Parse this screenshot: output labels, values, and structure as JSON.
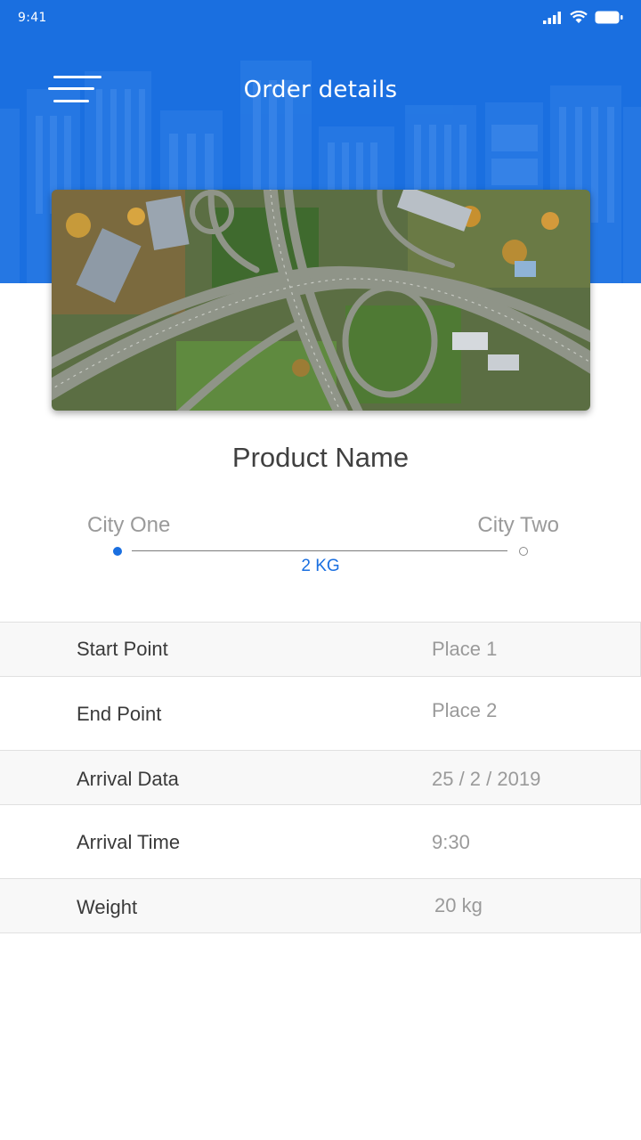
{
  "status_bar": {
    "time": "9:41",
    "icons": [
      "signal-icon",
      "wifi-icon",
      "battery-icon"
    ]
  },
  "header": {
    "title": "Order details",
    "menu_icon": "menu-icon",
    "background_color": "#1a6fe0"
  },
  "hero": {
    "image_description": "aerial-highway-interchange"
  },
  "product": {
    "name": "Product Name"
  },
  "route": {
    "origin": "City One",
    "destination": "City Two",
    "weight": "2 KG",
    "accent_color": "#1a6fe0"
  },
  "details": [
    {
      "label": "Start Point",
      "value": "Place 1"
    },
    {
      "label": "End Point",
      "value": "Place 2"
    },
    {
      "label": "Arrival Data",
      "value": "25 / 2 / 2019"
    },
    {
      "label": "Arrival Time",
      "value": "9:30"
    },
    {
      "label": "Weight",
      "value": "20 kg"
    }
  ]
}
